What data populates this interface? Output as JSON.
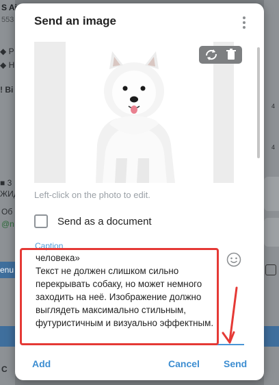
{
  "background": {
    "top_left_text": "S Ai",
    "top_left_sub": "553",
    "item1": "P",
    "item2": "H",
    "item3": "Bi",
    "item4_line1": "3",
    "item4_line2": "ЖИД",
    "item5": "Об",
    "item6": "@n",
    "blue_btn": "enu",
    "bottom_item": "C",
    "right_num1": "4",
    "right_num2": "4"
  },
  "dialog": {
    "title": "Send an image",
    "menu_icon": "more-vertical-icon",
    "photo_tools": [
      "replace-icon",
      "trash-icon"
    ],
    "hint": "Left-click on the photo to edit.",
    "send_as_document": {
      "label": "Send as a document",
      "checked": false
    },
    "caption": {
      "label": "Caption",
      "lines": [
        "человека»",
        "",
        "Текст не должен слишком сильно",
        "перекрывать собаку, но может немного",
        "заходить на неё. Изображение должно",
        "выглядеть максимально стильным,",
        "футуристичным и визуально эффектным."
      ]
    },
    "buttons": {
      "add": "Add",
      "cancel": "Cancel",
      "send": "Send"
    }
  },
  "colors": {
    "accent": "#3c8dd1",
    "annotation": "#e53935",
    "overlay": "#7b7f83"
  }
}
